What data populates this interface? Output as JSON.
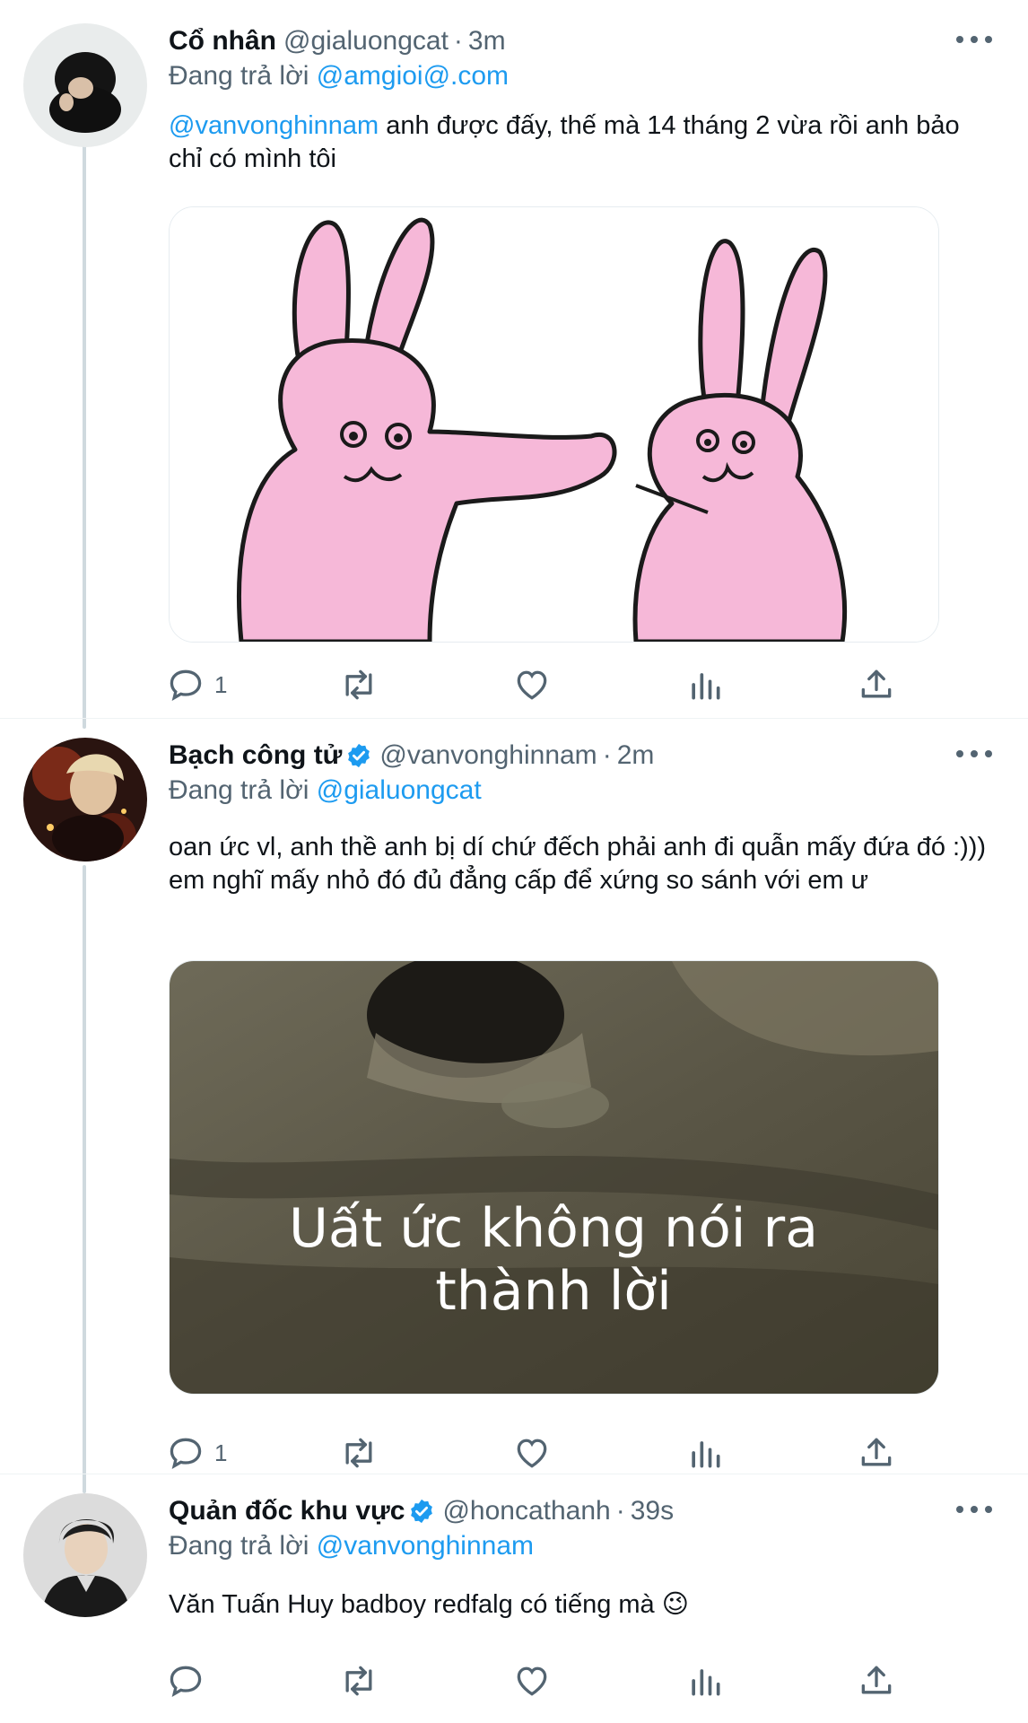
{
  "colors": {
    "accent": "#1d9bf0",
    "secondary_text": "#536471",
    "thread_line": "#cfd9de"
  },
  "tweets": [
    {
      "name": "Cổ nhân",
      "handle": "@gialuongcat",
      "time": "3m",
      "verified": false,
      "reply_prefix": "Đang trả lời",
      "reply_to": "@amgioi@.com",
      "text_mention": "@vanvonghinnam",
      "text": " anh được đấy, thế mà 14 tháng 2 vừa rồi anh bảo chỉ có mình tôi",
      "media_icon": "pink-rabbits-meme",
      "reply_count": "1"
    },
    {
      "name": "Bạch công tử",
      "handle": "@vanvonghinnam",
      "time": "2m",
      "verified": true,
      "reply_prefix": "Đang trả lời",
      "reply_to": "@gialuongcat",
      "text_line1": "oan ức vl, anh thề anh bị dí chứ đếch phải anh đi quẫn mấy đứa đó :)))",
      "text_line2": "em nghĩ mấy nhỏ đó đủ đẳng cấp để xứng so sánh với em ư",
      "media_caption_1": "Uất ức không nói ra",
      "media_caption_2": "thành lời",
      "reply_count": "1"
    },
    {
      "name": "Quản đốc khu vực",
      "handle": "@honcathanh",
      "time": "39s",
      "verified": true,
      "reply_prefix": "Đang trả lời",
      "reply_to": "@vanvonghinnam",
      "text": "Văn Tuấn Huy badboy redfalg có tiếng mà",
      "emoji": "😉",
      "reply_count": ""
    }
  ]
}
